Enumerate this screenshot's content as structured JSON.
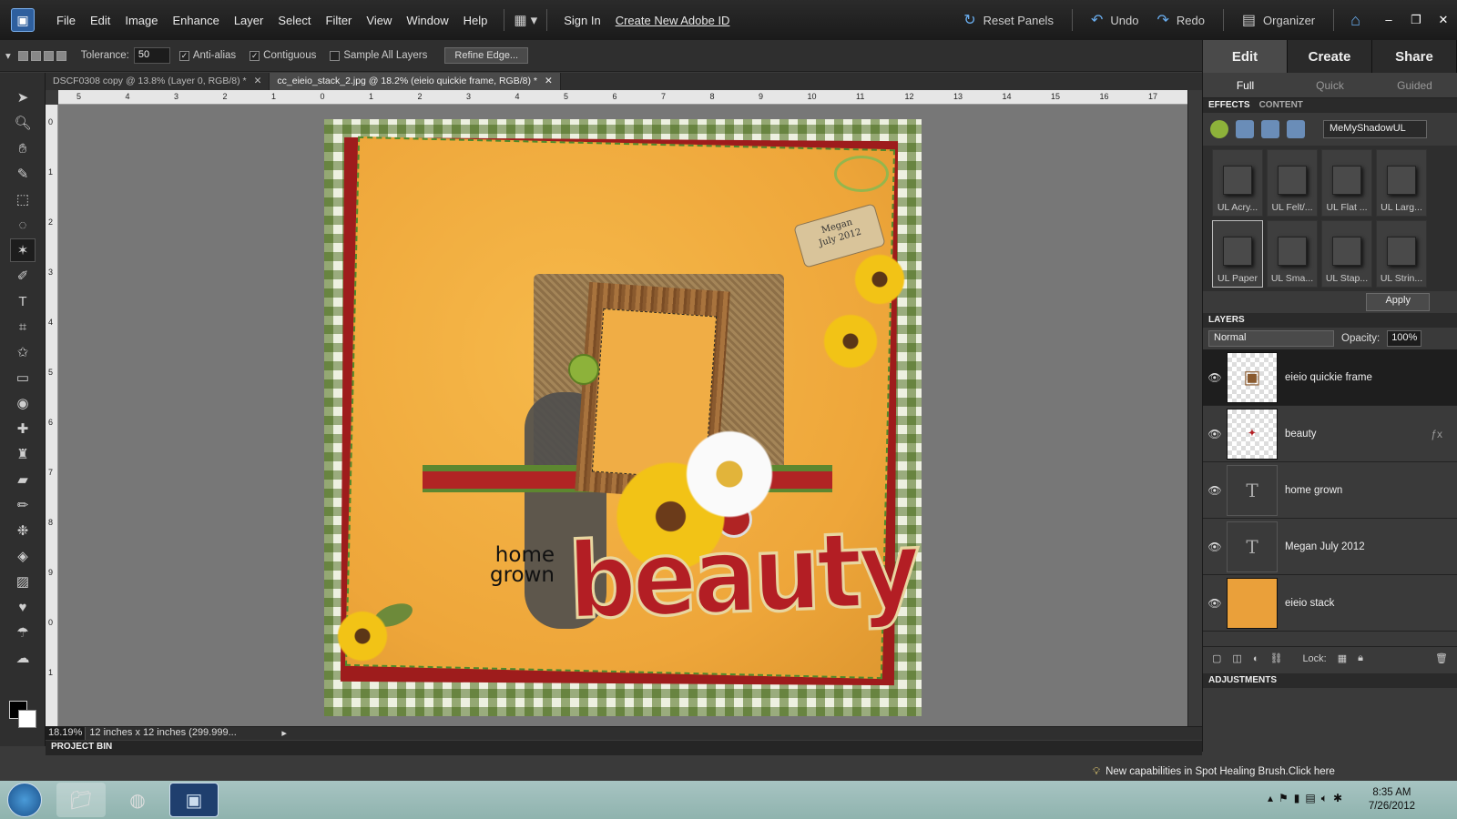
{
  "menubar": {
    "items": [
      "File",
      "Edit",
      "Image",
      "Enhance",
      "Layer",
      "Select",
      "Filter",
      "View",
      "Window",
      "Help"
    ],
    "sign_in": "Sign In",
    "create_id": "Create New Adobe ID",
    "reset_panels": "Reset Panels",
    "undo": "Undo",
    "redo": "Redo",
    "organizer": "Organizer"
  },
  "options": {
    "tolerance_label": "Tolerance:",
    "tolerance_value": "50",
    "anti_alias": "Anti-alias",
    "contiguous": "Contiguous",
    "sample_all": "Sample All Layers",
    "refine_edge": "Refine Edge..."
  },
  "tabs": [
    {
      "label": "DSCF0308 copy @ 13.8% (Layer 0, RGB/8) *"
    },
    {
      "label": "cc_eieio_stack_2.jpg @ 18.2% (eieio quickie frame, RGB/8) *"
    }
  ],
  "ruler_h": [
    "5",
    "4",
    "3",
    "2",
    "1",
    "0",
    "1",
    "2",
    "3",
    "4",
    "5",
    "6",
    "7",
    "8",
    "9",
    "10",
    "11",
    "12",
    "13",
    "14",
    "15",
    "16",
    "17"
  ],
  "ruler_v": [
    "0",
    "1",
    "2",
    "3",
    "4",
    "5",
    "6",
    "7",
    "8",
    "9",
    "0",
    "1"
  ],
  "status": {
    "zoom": "18.19%",
    "doc_info": "12 inches x 12 inches (299.999..."
  },
  "project_bin": "PROJECT BIN",
  "artwork": {
    "tag_line1": "Megan",
    "tag_line2": "July 2012",
    "home": "home",
    "grown": "grown",
    "beauty": "beauty"
  },
  "panels": {
    "modes": [
      "Edit",
      "Create",
      "Share"
    ],
    "submodes": [
      "Full",
      "Quick",
      "Guided"
    ],
    "effects_tab": "EFFECTS",
    "content_tab": "CONTENT",
    "fx_library": "MeMyShadowUL",
    "fx_items": [
      "UL Acry...",
      "UL Felt/...",
      "UL Flat ...",
      "UL Larg...",
      "UL Paper",
      "UL Sma...",
      "UL Stap...",
      "UL Strin..."
    ],
    "apply": "Apply",
    "layers_title": "LAYERS",
    "blend_mode": "Normal",
    "opacity_label": "Opacity:",
    "opacity_value": "100%",
    "layers": [
      {
        "name": "eieio quickie frame"
      },
      {
        "name": "beauty"
      },
      {
        "name": "home grown"
      },
      {
        "name": "Megan July 2012"
      },
      {
        "name": "eieio stack"
      }
    ],
    "lock_label": "Lock:",
    "adjustments": "ADJUSTMENTS"
  },
  "tip": "New capabilities in Spot Healing Brush.Click here",
  "taskbar": {
    "time": "8:35 AM",
    "date": "7/26/2012"
  },
  "colors": {
    "accent": "#6aaef0",
    "beauty_red": "#b31e24",
    "paper_yellow": "#eea63a"
  }
}
